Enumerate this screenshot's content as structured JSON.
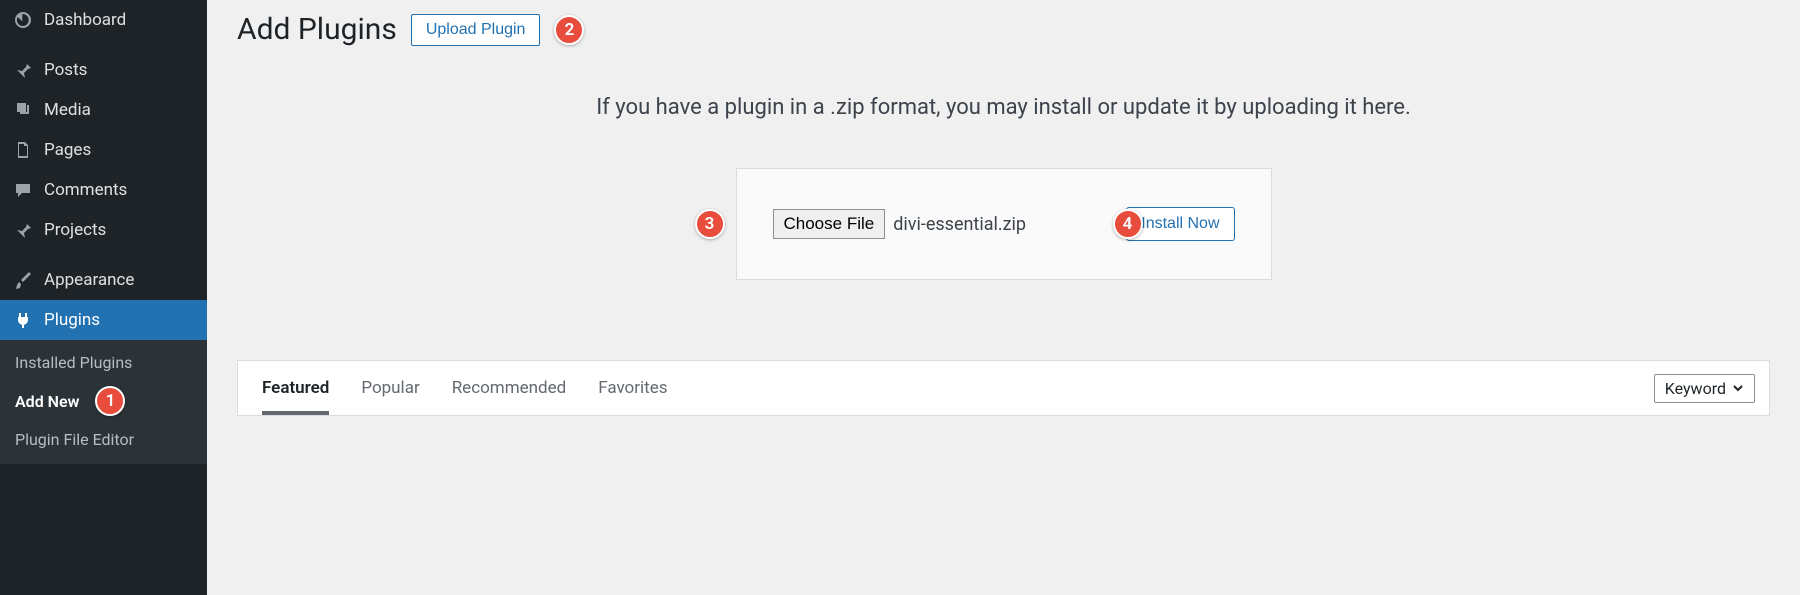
{
  "sidebar": {
    "items": [
      {
        "label": "Dashboard",
        "icon": "dashboard"
      },
      {
        "label": "Posts",
        "icon": "pin"
      },
      {
        "label": "Media",
        "icon": "media"
      },
      {
        "label": "Pages",
        "icon": "pages"
      },
      {
        "label": "Comments",
        "icon": "comment"
      },
      {
        "label": "Projects",
        "icon": "pin"
      },
      {
        "label": "Appearance",
        "icon": "brush"
      },
      {
        "label": "Plugins",
        "icon": "plug"
      }
    ],
    "submenu": [
      {
        "label": "Installed Plugins"
      },
      {
        "label": "Add New"
      },
      {
        "label": "Plugin File Editor"
      }
    ]
  },
  "header": {
    "title": "Add Plugins",
    "upload_button": "Upload Plugin"
  },
  "upload": {
    "instructions": "If you have a plugin in a .zip format, you may install or update it by uploading it here.",
    "choose_file_label": "Choose File",
    "file_name": "divi-essential.zip",
    "install_label": "Install Now"
  },
  "tabs": {
    "items": [
      {
        "label": "Featured"
      },
      {
        "label": "Popular"
      },
      {
        "label": "Recommended"
      },
      {
        "label": "Favorites"
      }
    ],
    "filter_label": "Keyword"
  },
  "badges": {
    "b1": "1",
    "b2": "2",
    "b3": "3",
    "b4": "4"
  }
}
